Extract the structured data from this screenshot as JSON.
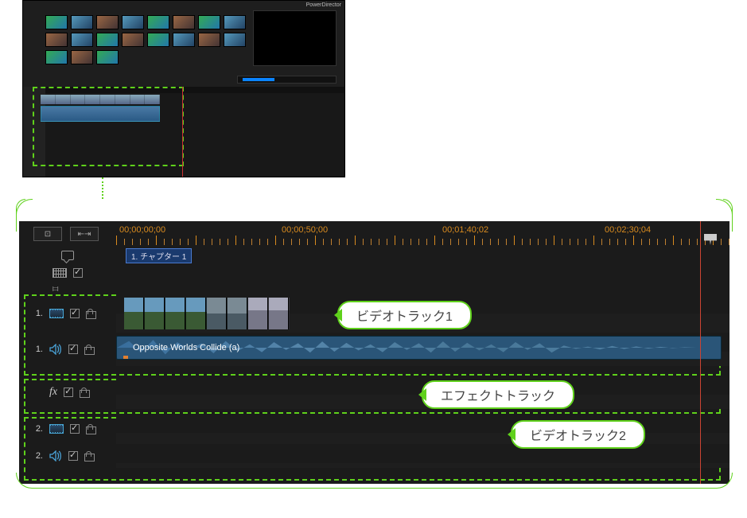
{
  "app": {
    "name": "PowerDirector"
  },
  "ruler": {
    "timecodes": [
      "00;00;00;00",
      "00;00;50;00",
      "00;01;40;02",
      "00;02;30;04"
    ]
  },
  "chapter": {
    "marker_label": "1. チャプター 1"
  },
  "tracks": {
    "video1": {
      "number": "1."
    },
    "audio1": {
      "number": "1.",
      "clip_name": "Opposite Worlds Collide (a)"
    },
    "fx": {},
    "video2": {
      "number": "2."
    },
    "audio2": {
      "number": "2."
    }
  },
  "callouts": {
    "video_track_1": "ビデオトラック1",
    "effect_track": "エフェクトトラック",
    "video_track_2": "ビデオトラック2"
  }
}
